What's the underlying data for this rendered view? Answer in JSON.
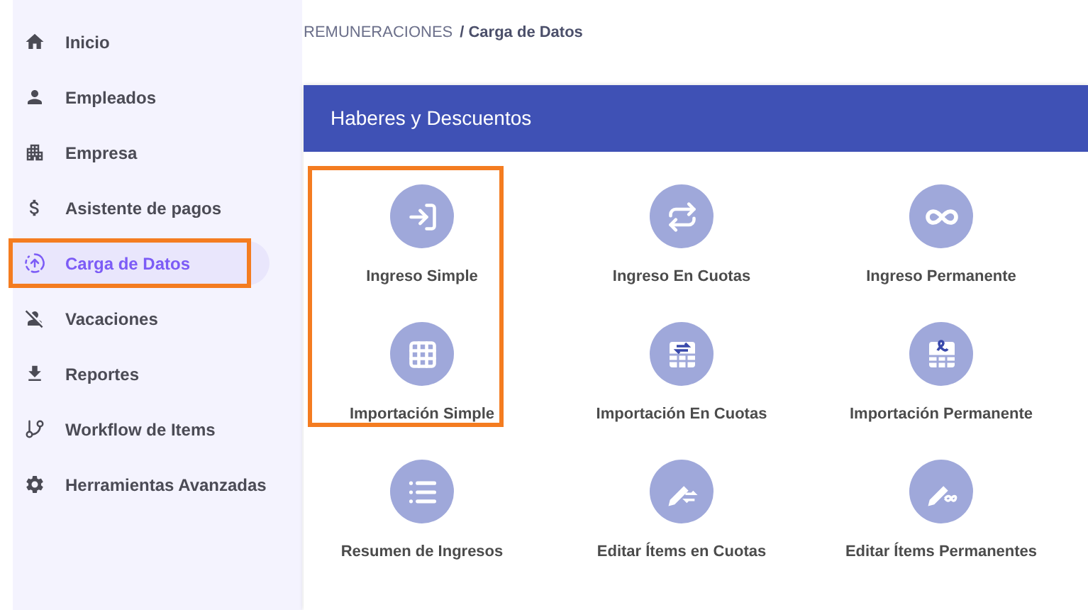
{
  "sidebar": {
    "items": [
      {
        "label": "Inicio",
        "selected": false,
        "highlighted": false
      },
      {
        "label": "Empleados",
        "selected": false,
        "highlighted": false
      },
      {
        "label": "Empresa",
        "selected": false,
        "highlighted": false
      },
      {
        "label": "Asistente de pagos",
        "selected": false,
        "highlighted": false
      },
      {
        "label": "Carga de Datos",
        "selected": true,
        "highlighted": true
      },
      {
        "label": "Vacaciones",
        "selected": false,
        "highlighted": false
      },
      {
        "label": "Reportes",
        "selected": false,
        "highlighted": false
      },
      {
        "label": "Workflow de Items",
        "selected": false,
        "highlighted": false
      },
      {
        "label": "Herramientas Avanzadas",
        "selected": false,
        "highlighted": false
      }
    ]
  },
  "breadcrumb": [
    "REMUNERACIONES",
    "/ Carga de Datos"
  ],
  "card": {
    "title": "Haberes y Descuentos",
    "tiles": [
      {
        "label": "Ingreso Simple",
        "highlighted": true
      },
      {
        "label": "Ingreso En Cuotas",
        "highlighted": false
      },
      {
        "label": "Ingreso Permanente",
        "highlighted": false
      },
      {
        "label": "Importación Simple",
        "highlighted": true
      },
      {
        "label": "Importación En Cuotas",
        "highlighted": false
      },
      {
        "label": "Importación Permanente",
        "highlighted": false
      },
      {
        "label": "Resumen de Ingresos",
        "highlighted": false
      },
      {
        "label": "Editar Ítems en Cuotas",
        "highlighted": false
      },
      {
        "label": "Editar Ítems Permanentes",
        "highlighted": false
      }
    ]
  }
}
